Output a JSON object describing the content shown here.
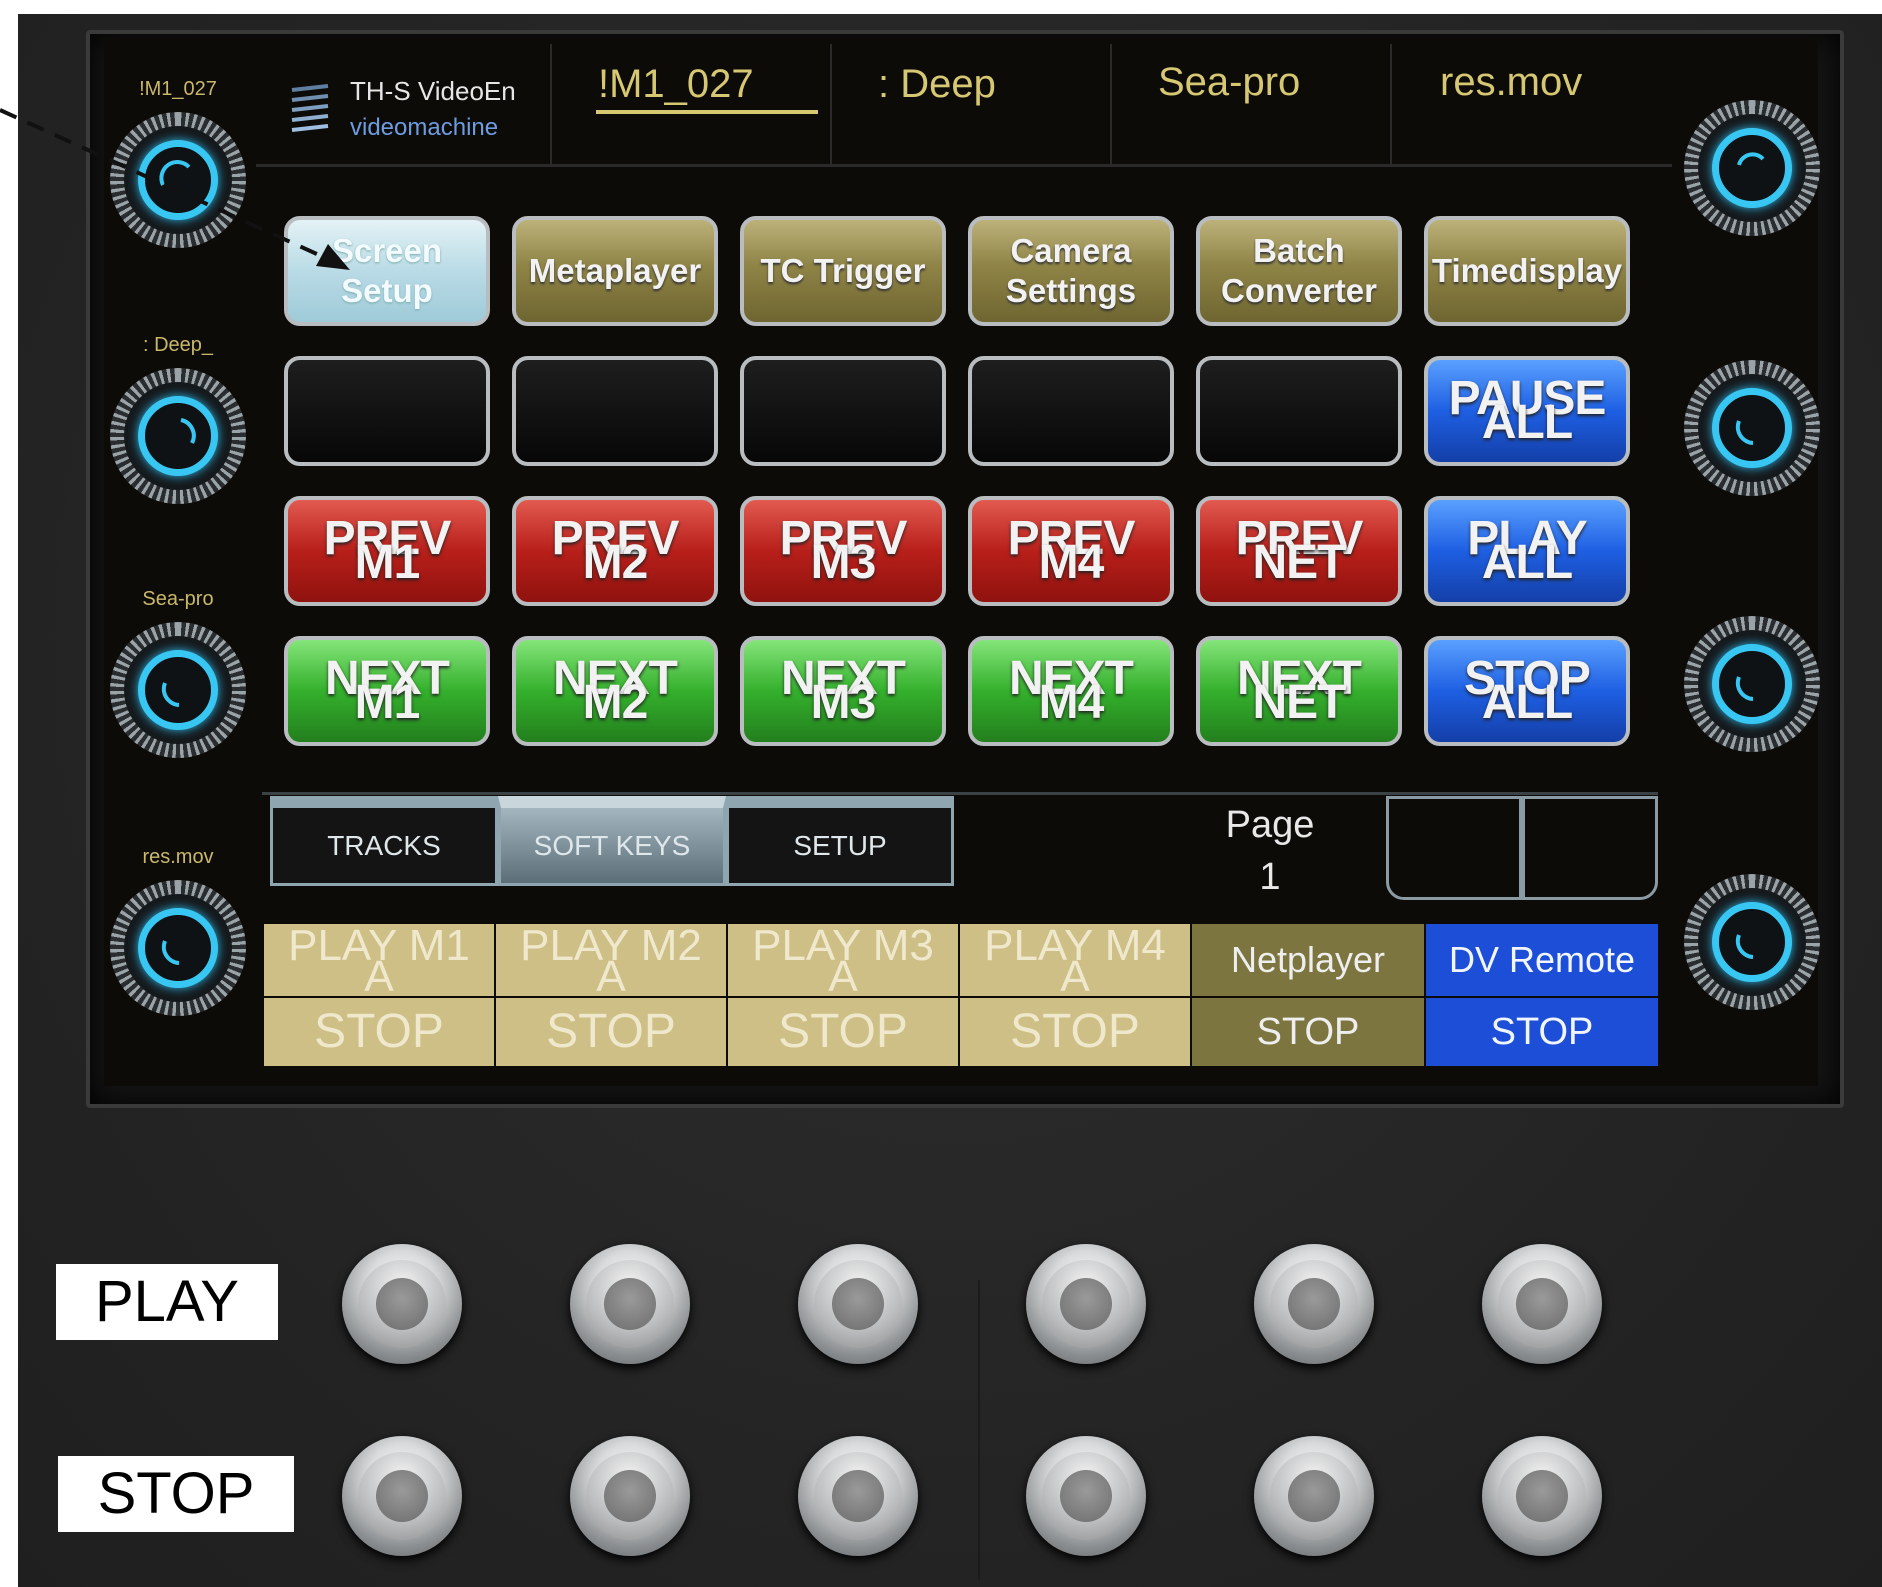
{
  "header": {
    "logo_line1": "TH-S VideoEn",
    "logo_line2": "videomachine",
    "fields": [
      "!M1_027",
      ": Deep",
      "Sea-pro",
      "res.mov"
    ]
  },
  "knobs_left": [
    {
      "label": "!M1_027"
    },
    {
      "label": ": Deep_"
    },
    {
      "label": "Sea-pro"
    },
    {
      "label": "res.mov"
    }
  ],
  "softkeys_row1": [
    {
      "l1": "Screen",
      "l2": "Setup"
    },
    {
      "l1": "Metaplayer",
      "l2": ""
    },
    {
      "l1": "TC Trigger",
      "l2": ""
    },
    {
      "l1": "Camera",
      "l2": "Settings"
    },
    {
      "l1": "Batch",
      "l2": "Converter"
    },
    {
      "l1": "Timedisplay",
      "l2": ""
    }
  ],
  "pause_all": {
    "a": "PAUSE",
    "b": "ALL"
  },
  "prev_row": [
    {
      "a": "PREV",
      "b": "M1"
    },
    {
      "a": "PREV",
      "b": "M2"
    },
    {
      "a": "PREV",
      "b": "M3"
    },
    {
      "a": "PREV",
      "b": "M4"
    },
    {
      "a": "PREV",
      "b": "NET"
    }
  ],
  "play_all": {
    "a": "PLAY",
    "b": "ALL"
  },
  "next_row": [
    {
      "a": "NEXT",
      "b": "M1"
    },
    {
      "a": "NEXT",
      "b": "M2"
    },
    {
      "a": "NEXT",
      "b": "M3"
    },
    {
      "a": "NEXT",
      "b": "M4"
    },
    {
      "a": "NEXT",
      "b": "NET"
    }
  ],
  "stop_all": {
    "a": "STOP",
    "b": "ALL"
  },
  "tabs": [
    "TRACKS",
    "SOFT KEYS",
    "SETUP"
  ],
  "page": {
    "label": "Page",
    "number": "1"
  },
  "assign_top": [
    {
      "a": "PLAY M1",
      "b": "A"
    },
    {
      "a": "PLAY M2",
      "b": "A"
    },
    {
      "a": "PLAY M3",
      "b": "A"
    },
    {
      "a": "PLAY M4",
      "b": "A"
    },
    {
      "a": "Netplayer",
      "b": ""
    },
    {
      "a": "DV Remote",
      "b": ""
    }
  ],
  "assign_bottom": [
    "STOP",
    "STOP",
    "STOP",
    "STOP",
    "STOP",
    "STOP"
  ],
  "hardware": {
    "play_label": "PLAY",
    "stop_label": "STOP"
  },
  "colors": {
    "accent_cyan": "#38c7f2",
    "header_gold": "#d6c773",
    "olive": "#7c7540",
    "tan": "#cdbf86",
    "blue": "#1d4ed8",
    "red": "#b81f1a",
    "green": "#34b02c"
  }
}
